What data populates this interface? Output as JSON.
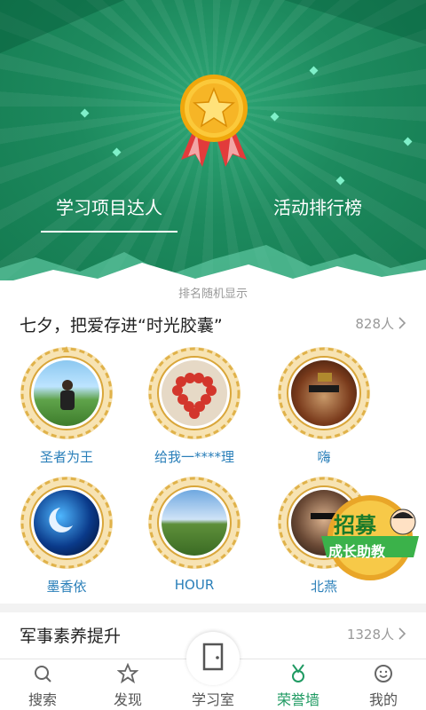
{
  "header": {
    "tabs": [
      {
        "label": "学习项目达人",
        "active": true
      },
      {
        "label": "活动排行榜",
        "active": false
      }
    ],
    "medal_icon": "gold-star-medal-icon",
    "colors": {
      "primary": "#1d8a5e",
      "accent": "#f4b51e",
      "ribbon": "#e23b3b"
    }
  },
  "list": {
    "hint": "排名随机显示",
    "sections": [
      {
        "title": "七夕，把爱存进“时光胶囊”",
        "count": "828人",
        "people": [
          {
            "name": "圣者为王"
          },
          {
            "name": "给我一****理"
          },
          {
            "name": "嗨"
          },
          {
            "name": "墨香依"
          },
          {
            "name": "HOUR"
          },
          {
            "name": "北燕"
          }
        ]
      },
      {
        "title": "军事素养提升",
        "count": "1328人"
      }
    ]
  },
  "promo": {
    "line1": "招募",
    "line2": "成长助教"
  },
  "nav": {
    "items": [
      {
        "label": "搜索",
        "icon": "search-icon",
        "active": false
      },
      {
        "label": "发现",
        "icon": "star-icon",
        "active": false
      },
      {
        "label": "学习室",
        "icon": "door-icon",
        "active": false
      },
      {
        "label": "荣誉墙",
        "icon": "medal-icon",
        "active": true
      },
      {
        "label": "我的",
        "icon": "smiley-icon",
        "active": false
      }
    ]
  }
}
